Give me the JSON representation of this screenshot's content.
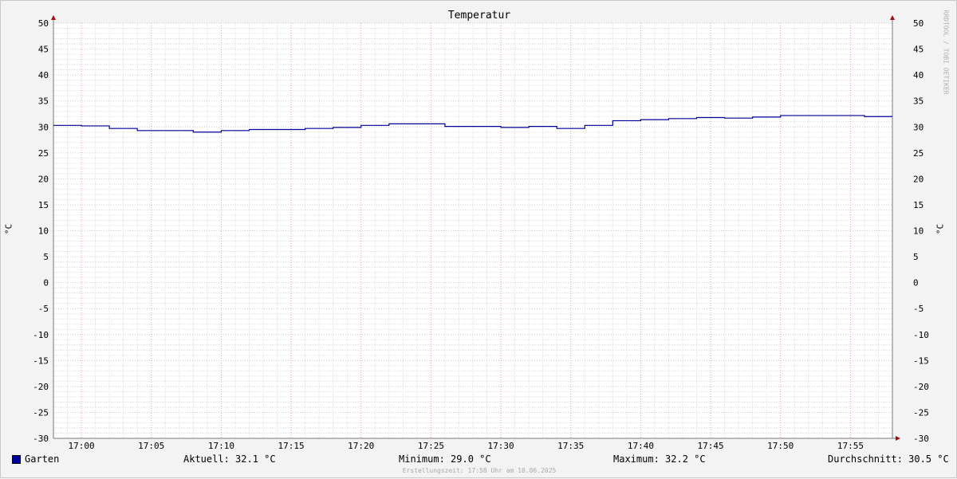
{
  "chart_data": {
    "type": "line",
    "title": "Temperatur",
    "ylabel": "°C",
    "ylim": [
      -30,
      50
    ],
    "y_ticks": [
      50,
      45,
      40,
      35,
      30,
      25,
      20,
      15,
      10,
      5,
      0,
      -5,
      -10,
      -15,
      -20,
      -25,
      -30
    ],
    "x_ticks": [
      "17:00",
      "17:05",
      "17:10",
      "17:15",
      "17:20",
      "17:25",
      "17:30",
      "17:35",
      "17:40",
      "17:45",
      "17:50",
      "17:55"
    ],
    "xlim": [
      "16:58",
      "17:58"
    ],
    "grid": true,
    "series": [
      {
        "name": "Garten",
        "color": "#000099",
        "step": true,
        "points": [
          [
            "16:58",
            30.3
          ],
          [
            "17:00",
            30.2
          ],
          [
            "17:02",
            29.7
          ],
          [
            "17:04",
            29.3
          ],
          [
            "17:08",
            29.0
          ],
          [
            "17:10",
            29.3
          ],
          [
            "17:12",
            29.5
          ],
          [
            "17:16",
            29.7
          ],
          [
            "17:18",
            29.9
          ],
          [
            "17:20",
            30.3
          ],
          [
            "17:22",
            30.6
          ],
          [
            "17:26",
            30.1
          ],
          [
            "17:30",
            29.9
          ],
          [
            "17:32",
            30.1
          ],
          [
            "17:34",
            29.7
          ],
          [
            "17:36",
            30.3
          ],
          [
            "17:38",
            31.2
          ],
          [
            "17:40",
            31.4
          ],
          [
            "17:42",
            31.6
          ],
          [
            "17:44",
            31.8
          ],
          [
            "17:46",
            31.7
          ],
          [
            "17:48",
            31.9
          ],
          [
            "17:50",
            32.2
          ],
          [
            "17:56",
            32.0
          ],
          [
            "17:58",
            32.0
          ]
        ]
      }
    ]
  },
  "legend": {
    "series_name": "Garten",
    "current": "Aktuell: 32.1 °C",
    "minimum": "Minimum: 29.0 °C",
    "maximum": "Maximum: 32.2 °C",
    "average": "Durchschnitt: 30.5 °C"
  },
  "footer": {
    "created": "Erstellungszeit: 17:58 Uhr am 18.06.2025",
    "watermark": "RRDTOOL / TOBI OETIKER"
  }
}
